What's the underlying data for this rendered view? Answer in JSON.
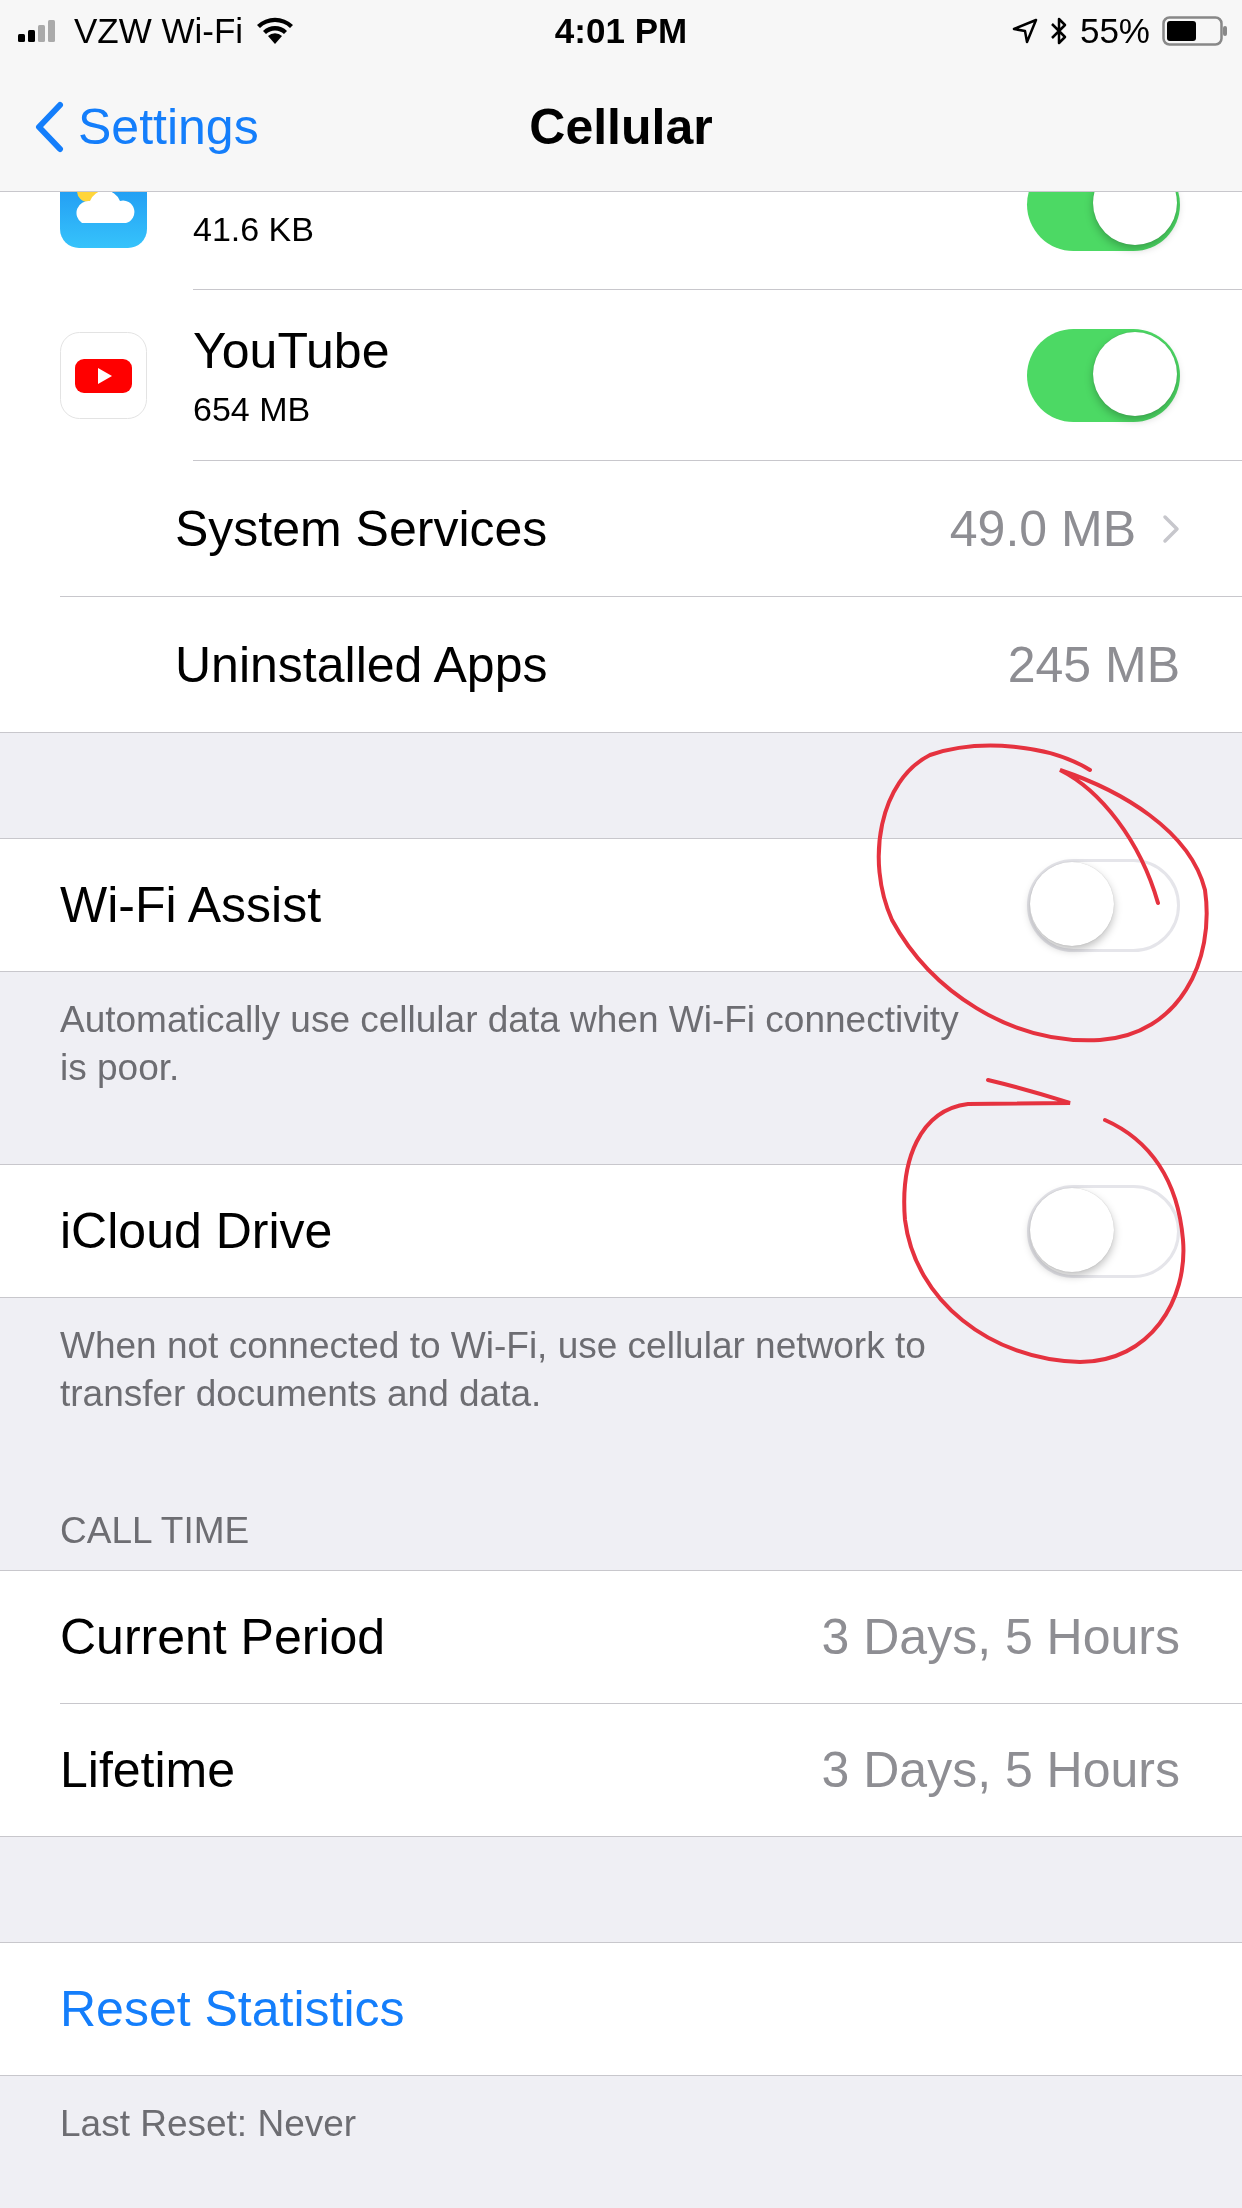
{
  "status_bar": {
    "carrier": "VZW Wi-Fi",
    "time": "4:01 PM",
    "battery": "55%"
  },
  "nav": {
    "back": "Settings",
    "title": "Cellular"
  },
  "apps": [
    {
      "kind": "weather",
      "usage": "41.6 KB",
      "on": true
    },
    {
      "kind": "youtube",
      "name": "YouTube",
      "usage": "654 MB",
      "on": true
    }
  ],
  "usage_rows": [
    {
      "label": "System Services",
      "value": "49.0 MB",
      "chevron": true
    },
    {
      "label": "Uninstalled Apps",
      "value": "245 MB",
      "chevron": false
    }
  ],
  "toggles": [
    {
      "label": "Wi-Fi Assist",
      "on": false,
      "footer": "Automatically use cellular data when Wi-Fi connectivity is poor."
    },
    {
      "label": "iCloud Drive",
      "on": false,
      "footer": "When not connected to Wi-Fi, use cellular network to transfer documents and data."
    }
  ],
  "call_time": {
    "header": "CALL TIME",
    "rows": [
      {
        "label": "Current Period",
        "value": "3 Days, 5 Hours"
      },
      {
        "label": "Lifetime",
        "value": "3 Days, 5 Hours"
      }
    ]
  },
  "reset": {
    "label": "Reset Statistics",
    "footer": "Last Reset: Never"
  }
}
